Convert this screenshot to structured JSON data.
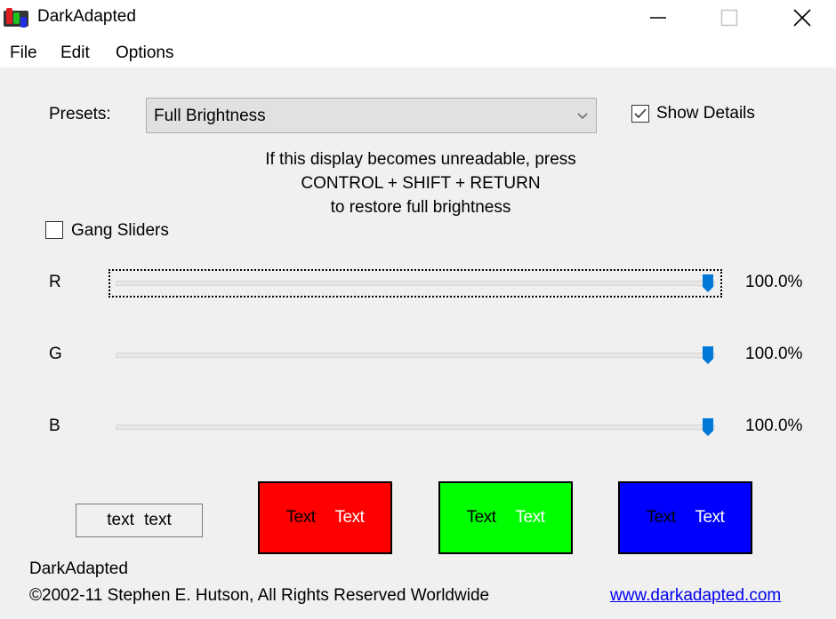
{
  "window": {
    "title": "DarkAdapted",
    "controls": {
      "minimize": "minimize-icon",
      "maximize": "maximize-icon",
      "close": "close-icon"
    }
  },
  "menu": {
    "items": [
      {
        "label": "File"
      },
      {
        "label": "Edit"
      },
      {
        "label": "Options"
      }
    ]
  },
  "presets": {
    "label": "Presets:",
    "selected": "Full Brightness"
  },
  "show_details": {
    "label": "Show Details",
    "checked": true
  },
  "warning": {
    "line1": "If this display becomes unreadable, press",
    "line2": "CONTROL + SHIFT + RETURN",
    "line3": "to restore full brightness"
  },
  "gang_sliders": {
    "label": "Gang Sliders",
    "checked": false
  },
  "sliders": [
    {
      "channel": "R",
      "value_percent": 100.0,
      "display": "100.0%",
      "focused": true
    },
    {
      "channel": "G",
      "value_percent": 100.0,
      "display": "100.0%",
      "focused": false
    },
    {
      "channel": "B",
      "value_percent": 100.0,
      "display": "100.0%",
      "focused": false
    }
  ],
  "colors": {
    "thumb": "#0078d7",
    "red": "#ff0000",
    "green": "#00ff00",
    "blue": "#0000ff"
  },
  "sample_text": "text  text",
  "swatches": [
    {
      "name": "red",
      "dark_text": "Text",
      "light_text": "Text"
    },
    {
      "name": "green",
      "dark_text": "Text",
      "light_text": "Text"
    },
    {
      "name": "blue",
      "dark_text": "Text",
      "light_text": "Text"
    }
  ],
  "footer": {
    "app_name": "DarkAdapted",
    "copyright": "©2002-11 Stephen E. Hutson, All Rights Reserved Worldwide",
    "link": "www.darkadapted.com"
  }
}
